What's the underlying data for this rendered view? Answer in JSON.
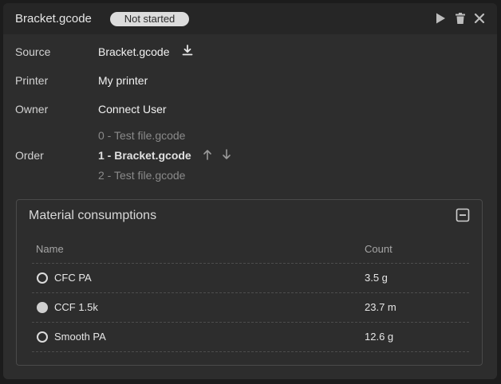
{
  "header": {
    "title": "Bracket.gcode",
    "status": "Not started",
    "icons": [
      "play-icon",
      "trash-icon",
      "close-icon"
    ]
  },
  "details": {
    "source_label": "Source",
    "source_value": "Bracket.gcode",
    "printer_label": "Printer",
    "printer_value": "My printer",
    "owner_label": "Owner",
    "owner_value": "Connect User",
    "order_label": "Order",
    "order_items": [
      "0 - Test file.gcode",
      "1 - Bracket.gcode",
      "2 - Test file.gcode"
    ]
  },
  "materials": {
    "title": "Material consumptions",
    "columns": [
      "Name",
      "Count"
    ],
    "rows": [
      {
        "name": "CFC PA",
        "count": "3.5 g",
        "selected": false
      },
      {
        "name": "CCF 1.5k",
        "count": "23.7 m",
        "selected": true
      },
      {
        "name": "Smooth PA",
        "count": "12.6 g",
        "selected": false
      }
    ]
  },
  "colors": {
    "panel": "#2d2d2d",
    "header": "#262626",
    "badge": "#dcdcdc",
    "text": "#e6e6e6",
    "muted": "#8a8a8a"
  }
}
